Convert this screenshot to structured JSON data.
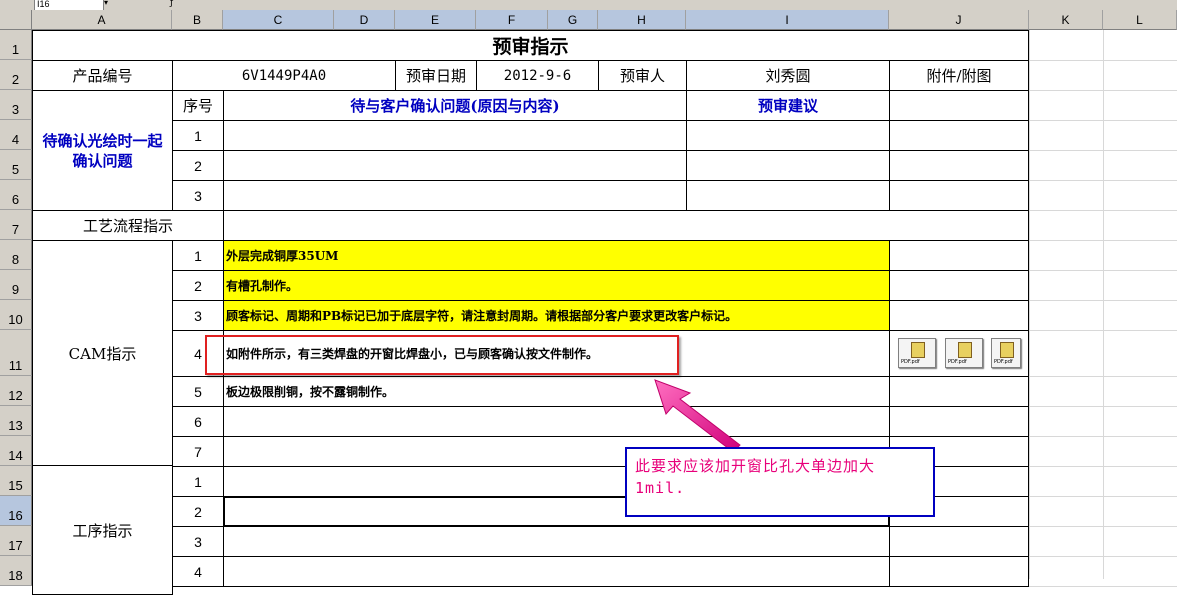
{
  "app": {
    "name_box": "I16",
    "name_box_arrow": "▾",
    "fx_label": "ƒ",
    "columns": [
      "A",
      "B",
      "C",
      "D",
      "E",
      "F",
      "G",
      "H",
      "I",
      "J",
      "K",
      "L"
    ],
    "rows": [
      "1",
      "2",
      "3",
      "4",
      "5",
      "6",
      "7",
      "8",
      "9",
      "10",
      "11",
      "12",
      "13",
      "14",
      "15",
      "16",
      "17",
      "18"
    ]
  },
  "sheet": {
    "title": "预审指示",
    "product_label": "产品编号",
    "product_value": "6V1449P4A0",
    "review_date_label": "预审日期",
    "review_date_value": "2012-9-6",
    "reviewer_label": "预审人",
    "reviewer_value": "刘秀圆",
    "attachment_label": "附件/附图",
    "confirm_section_label": "待确认光绘时一起确认问题",
    "seq_label": "序号",
    "issue_header": "待与客户确认问题(原因与内容)",
    "suggestion_header": "预审建议",
    "confirm_nums": [
      "1",
      "2",
      "3"
    ],
    "process_flow_label": "工艺流程指示",
    "cam_label": "CAM指示",
    "cam_nums": [
      "1",
      "2",
      "3",
      "4",
      "5",
      "6",
      "7"
    ],
    "cam_texts": [
      "外层完成铜厚35UM",
      "有槽孔制作。",
      "顾客标记、周期和PB标记已加于底层字符，请注意封周期。请根据部分客户要求更改客户标记。",
      "如附件所示，有三类焊盘的开窗比焊盘小，已与顾客确认按文件制作。",
      "板边极限削铜，按不露铜制作。",
      "",
      ""
    ],
    "process_label": "工序指示",
    "process_nums": [
      "1",
      "2",
      "3",
      "4"
    ]
  },
  "annotation": {
    "callout_text": "此要求应该加开窗比孔大单边加大1mil.",
    "callout_color": "#e8007a",
    "callout_border": "#0000c0",
    "highlight_color": "#e02020"
  },
  "attachments": [
    {
      "icon": "embedded-object-icon",
      "label": "PDF.pdf"
    },
    {
      "icon": "embedded-object-icon",
      "label": "PDF.pdf"
    },
    {
      "icon": "embedded-object-icon",
      "label": "PDF.pdf"
    }
  ]
}
